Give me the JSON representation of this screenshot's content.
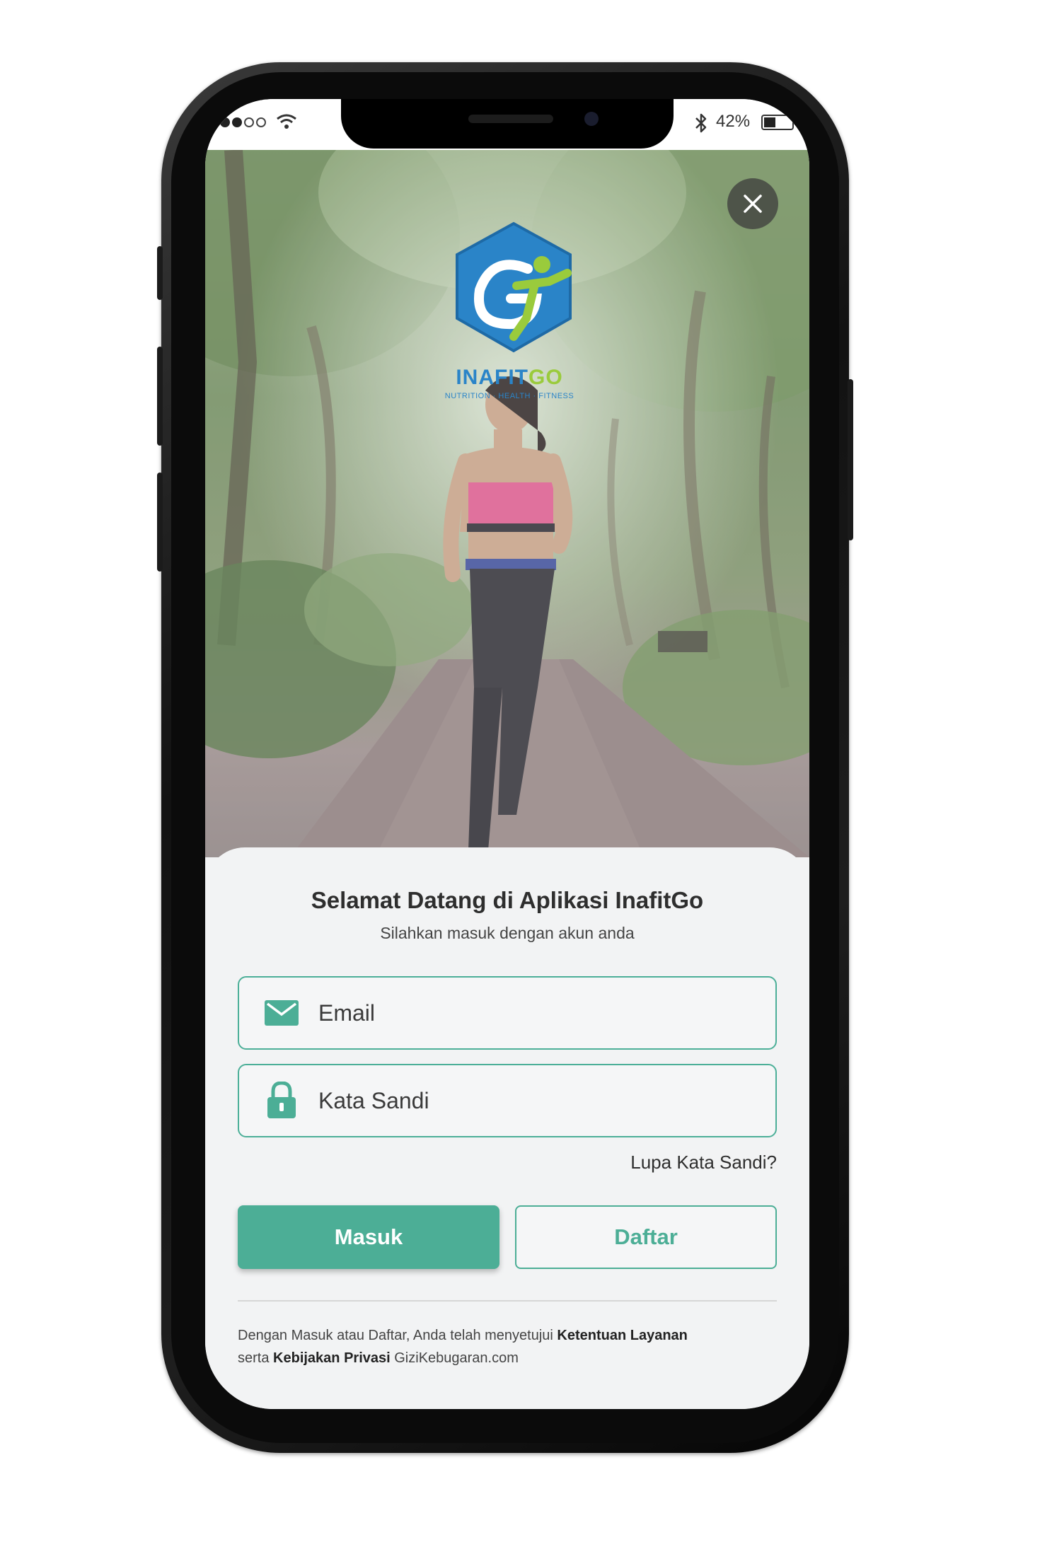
{
  "status_bar": {
    "battery_text": "42%",
    "signal_bars_filled": 3,
    "signal_bars_total": 5,
    "battery_level": 0.42
  },
  "logo": {
    "name_part1": "INAFIT",
    "name_part2": "GO",
    "tagline": "NUTRITION · HEALTH · FITNESS"
  },
  "login": {
    "title": "Selamat Datang di Aplikasi InafitGo",
    "subtitle": "Silahkan masuk dengan akun anda",
    "email_placeholder": "Email",
    "password_placeholder": "Kata Sandi",
    "forgot_password": "Lupa Kata Sandi?",
    "login_button": "Masuk",
    "register_button": "Daftar"
  },
  "terms": {
    "prefix": "Dengan Masuk atau Daftar, Anda telah menyetujui ",
    "terms_link": "Ketentuan Layanan",
    "middle": "serta ",
    "privacy_link": "Kebijakan Privasi",
    "suffix": " GiziKebugaran.com"
  },
  "colors": {
    "accent": "#4cae96",
    "logo_blue": "#2a84c8",
    "logo_green": "#9acb3c"
  },
  "icons": [
    "close-icon",
    "email-icon",
    "lock-icon",
    "wifi-icon",
    "bluetooth-icon",
    "battery-icon"
  ]
}
